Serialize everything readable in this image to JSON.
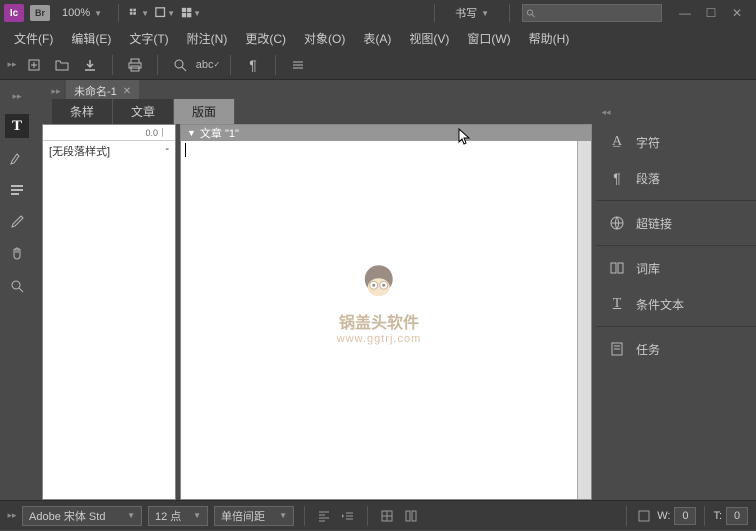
{
  "app": {
    "logo": "Ic",
    "br": "Br"
  },
  "titlebar": {
    "zoom": "100%",
    "workspace": "书写",
    "search_placeholder": ""
  },
  "menu": [
    "文件(F)",
    "编辑(E)",
    "文字(T)",
    "附注(N)",
    "更改(C)",
    "对象(O)",
    "表(A)",
    "视图(V)",
    "窗口(W)",
    "帮助(H)"
  ],
  "document": {
    "tab_name": "未命名-1",
    "sub_tabs": [
      "条样",
      "文章",
      "版面"
    ],
    "active_sub_tab": 2,
    "styles_header": "0.0",
    "style_entry": "[无段落样式]",
    "style_marker": "-",
    "content_header": "文章 \"1\""
  },
  "right_panels": [
    "字符",
    "段落",
    "超链接",
    "词库",
    "条件文本",
    "任务"
  ],
  "bottom": {
    "font": "Adobe 宋体 Std",
    "size": "12 点",
    "leading": "单倍间距",
    "w_label": "W:",
    "w_value": "0",
    "t_label": "T:",
    "t_value": "0"
  },
  "watermark": {
    "text": "锅盖头软件",
    "url": "www.ggtrj.com"
  },
  "icons": {
    "search": "⚲",
    "minimize": "—",
    "maximize": "☐",
    "close": "✕"
  }
}
